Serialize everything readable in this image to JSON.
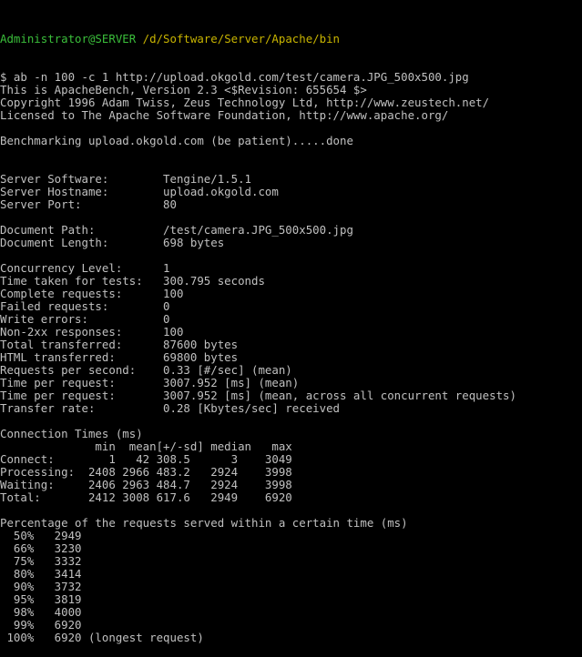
{
  "prompt": {
    "user": "Administrator@SERVER",
    "path": "/d/Software/Server/Apache/bin"
  },
  "lines": [
    "$ ab -n 100 -c 1 http://upload.okgold.com/test/camera.JPG_500x500.jpg",
    "This is ApacheBench, Version 2.3 <$Revision: 655654 $>",
    "Copyright 1996 Adam Twiss, Zeus Technology Ltd, http://www.zeustech.net/",
    "Licensed to The Apache Software Foundation, http://www.apache.org/",
    "",
    "Benchmarking upload.okgold.com (be patient).....done",
    "",
    "",
    "Server Software:        Tengine/1.5.1",
    "Server Hostname:        upload.okgold.com",
    "Server Port:            80",
    "",
    "Document Path:          /test/camera.JPG_500x500.jpg",
    "Document Length:        698 bytes",
    "",
    "Concurrency Level:      1",
    "Time taken for tests:   300.795 seconds",
    "Complete requests:      100",
    "Failed requests:        0",
    "Write errors:           0",
    "Non-2xx responses:      100",
    "Total transferred:      87600 bytes",
    "HTML transferred:       69800 bytes",
    "Requests per second:    0.33 [#/sec] (mean)",
    "Time per request:       3007.952 [ms] (mean)",
    "Time per request:       3007.952 [ms] (mean, across all concurrent requests)",
    "Transfer rate:          0.28 [Kbytes/sec] received",
    "",
    "Connection Times (ms)",
    "              min  mean[+/-sd] median   max",
    "Connect:        1   42 308.5      3    3049",
    "Processing:  2408 2966 483.2   2924    3998",
    "Waiting:     2406 2963 484.7   2924    3998",
    "Total:       2412 3008 617.6   2949    6920",
    "",
    "Percentage of the requests served within a certain time (ms)",
    "  50%   2949",
    "  66%   3230",
    "  75%   3332",
    "  80%   3414",
    "  90%   3732",
    "  95%   3819",
    "  98%   4000",
    "  99%   6920",
    " 100%   6920 (longest request)"
  ],
  "colors": {
    "background": "#000000",
    "text": "#c0c0c0",
    "prompt_user": "#3bbf3b",
    "prompt_path": "#c8b400"
  }
}
